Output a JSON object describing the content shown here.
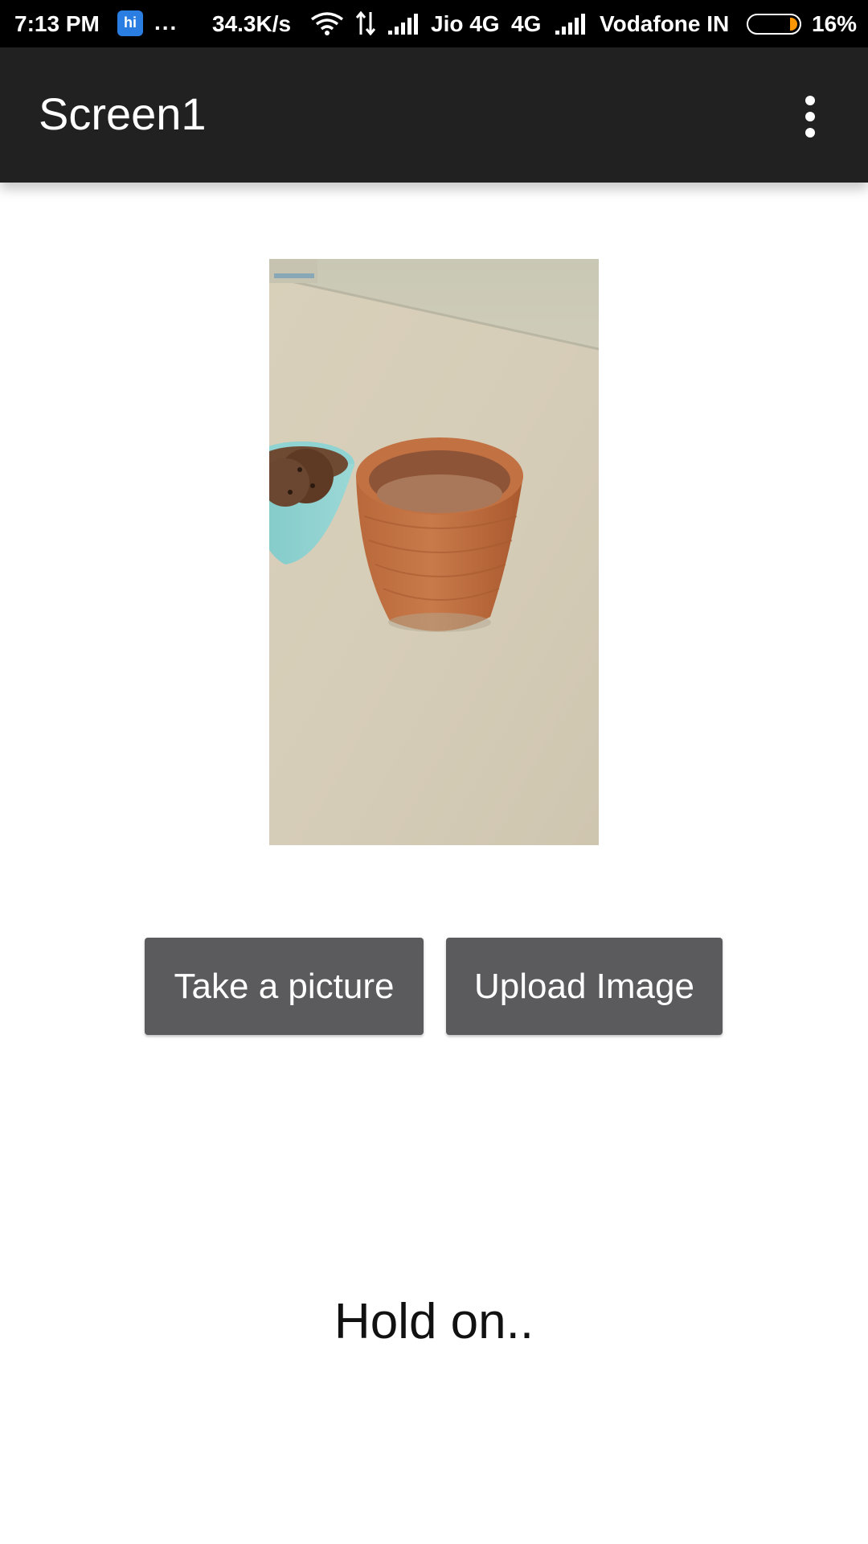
{
  "status_bar": {
    "time": "7:13 PM",
    "notification_dots": "...",
    "network_speed": "34.3K/s",
    "carrier_1": "Jio 4G",
    "network_type": "4G",
    "carrier_2": "Vodafone IN",
    "battery_level": 0.16,
    "battery_percent": "16%",
    "battery_color": "#ff9800"
  },
  "app_bar": {
    "title": "Screen1",
    "background": "#212121"
  },
  "photo": {
    "subject": "clay cup of tea beside bowl of cookies"
  },
  "buttons": {
    "take_picture": "Take a picture",
    "upload_image": "Upload Image",
    "background": "#5b5b5e"
  },
  "status_text": "Hold on.."
}
